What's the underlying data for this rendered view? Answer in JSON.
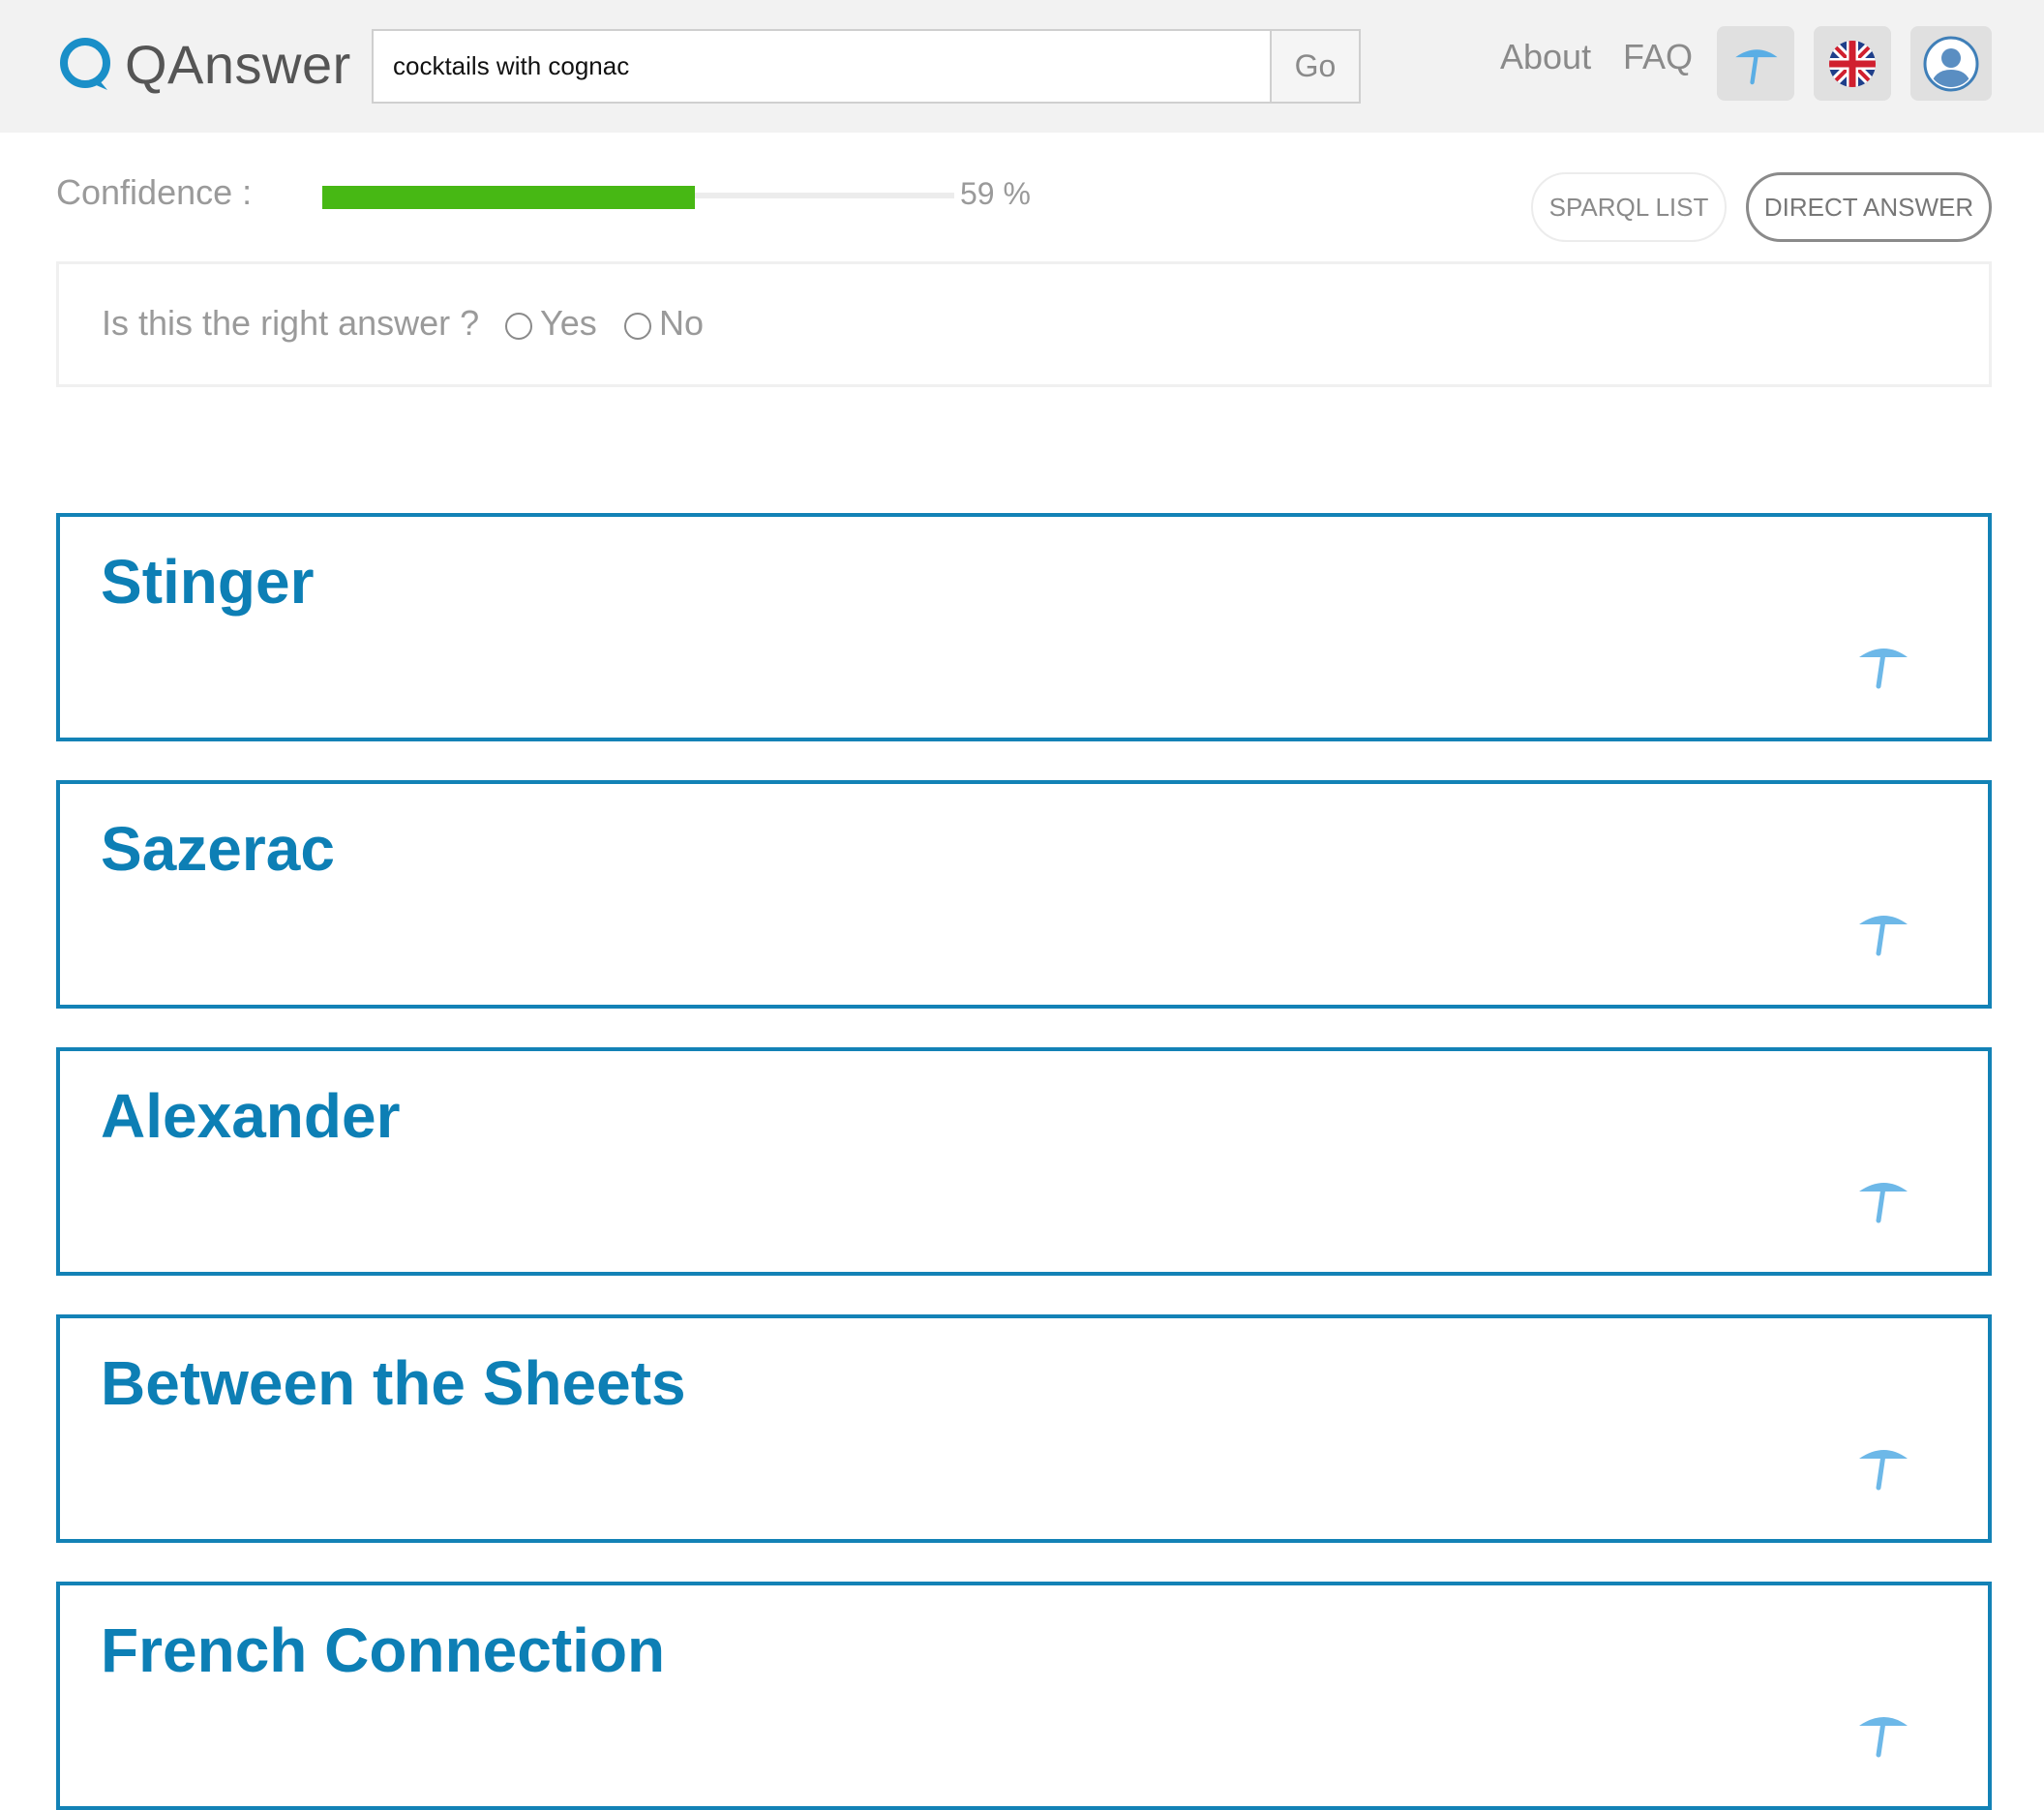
{
  "header": {
    "logo_text": "QAnswer",
    "search": {
      "value": "cocktails with cognac",
      "placeholder": ""
    },
    "go_label": "Go",
    "nav": {
      "about": "About",
      "faq": "FAQ"
    }
  },
  "confidence": {
    "label": "Confidence :",
    "percent": 59,
    "value_text": "59 %",
    "fill_color": "#47b814"
  },
  "mode_buttons": {
    "sparql_list": "SPARQL LIST",
    "direct_answer": "DIRECT ANSWER"
  },
  "feedback": {
    "question": "Is this the right answer ?",
    "yes": "Yes",
    "no": "No"
  },
  "results": [
    {
      "title": "Stinger",
      "icon": "umbrella-icon"
    },
    {
      "title": "Sazerac",
      "icon": "umbrella-icon"
    },
    {
      "title": "Alexander",
      "icon": "umbrella-icon"
    },
    {
      "title": "Between the Sheets",
      "icon": "umbrella-icon"
    },
    {
      "title": "French Connection",
      "icon": "umbrella-icon"
    }
  ],
  "colors": {
    "accent": "#1382b6",
    "title": "#0d7fb5",
    "umbrella": "#6db8e8"
  }
}
